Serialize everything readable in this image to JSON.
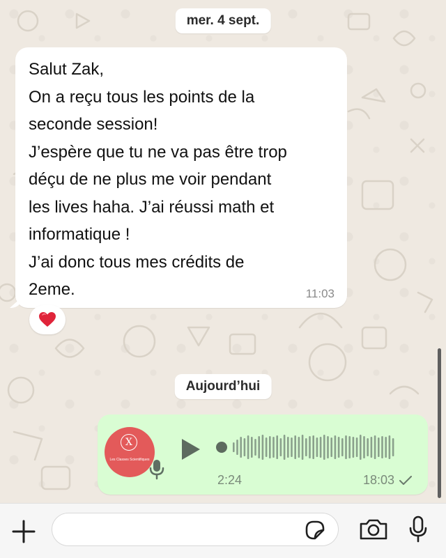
{
  "chat": {
    "date_separator_1": "mer. 4 sept.",
    "date_separator_2": "Aujourd’hui",
    "incoming_message": {
      "lines": [
        "Salut Zak,",
        "On a reçu tous les points de la",
        "seconde session!",
        "J’espère que tu ne va pas être trop",
        "déçu de ne plus me voir pendant",
        "les lives haha. J’ai réussi math et",
        "informatique !",
        "J’ai donc tous mes crédits de",
        "2eme."
      ],
      "time": "11:03",
      "reaction": "❤️"
    },
    "voice_message": {
      "avatar_letter": "X",
      "avatar_caption": "Les Classes Scientifiques",
      "duration": "2:24",
      "time": "18:03",
      "status_icon": "double-check-icon",
      "progress": 0
    }
  },
  "input_bar": {
    "placeholder": ""
  },
  "colors": {
    "chat_background": "#efe9e1",
    "incoming_bubble": "#ffffff",
    "outgoing_bubble": "#d9fdd3",
    "avatar": "#e35a5a",
    "icon_dark": "#1f1f1f"
  }
}
